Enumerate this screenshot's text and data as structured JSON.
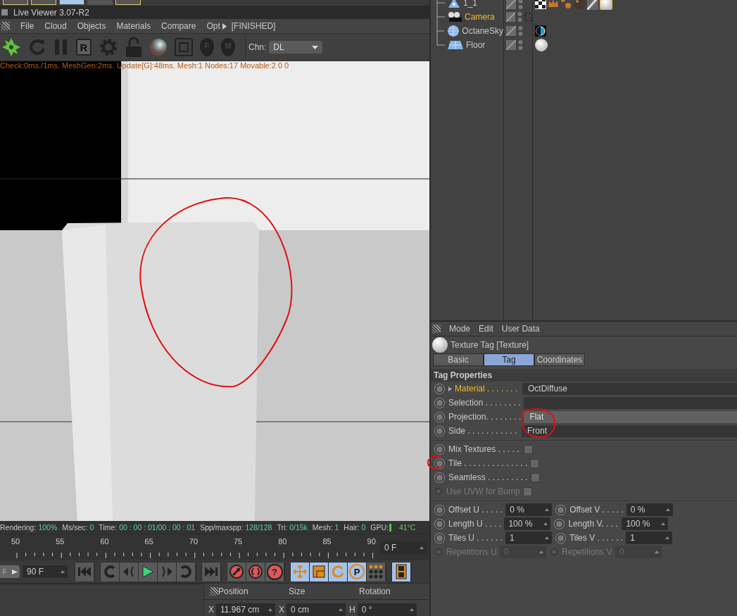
{
  "live_viewer": {
    "title": "Live Viewer 3.07-R2",
    "menu": [
      {
        "label": "File"
      },
      {
        "label": "Cloud"
      },
      {
        "label": "Objects"
      },
      {
        "label": "Materials"
      },
      {
        "label": "Compare"
      },
      {
        "label": "Opt"
      }
    ],
    "render_state": "[FINISHED]",
    "toolbar": [
      {
        "kind": "logo"
      },
      {
        "kind": "refresh"
      },
      {
        "kind": "pause"
      },
      {
        "kind": "letter",
        "glyph": "R"
      },
      {
        "kind": "gear"
      },
      {
        "kind": "lock"
      },
      {
        "kind": "sphere"
      },
      {
        "kind": "region"
      },
      {
        "kind": "pin",
        "glyph": "F"
      },
      {
        "kind": "pin",
        "glyph": "M"
      }
    ],
    "channel": {
      "label": "Chn:",
      "value": "DL"
    },
    "stats_line": "Check:0ms./1ms. MeshGen:2ms. Update[G]:48ms. Mesh:1 Nodes:17 Movable:2  0 0",
    "status": [
      {
        "label": "Rendering:",
        "value": "100%"
      },
      {
        "label": "Ms/sec:",
        "value": "0"
      },
      {
        "label": "Time:",
        "value": "00 : 00 : 01/00 : 00 : 01"
      },
      {
        "label": "Spp/maxspp:",
        "value": "128/128"
      },
      {
        "label": "Tri:",
        "value": "0/15k"
      },
      {
        "label": "Mesh:",
        "value": "1"
      },
      {
        "label": "Hair:",
        "value": "0"
      }
    ],
    "gpu": {
      "label": "GPU:",
      "value": "41°C"
    }
  },
  "timeline": {
    "ticks": [
      "50",
      "55",
      "60",
      "65",
      "70",
      "75",
      "80",
      "85",
      "90"
    ],
    "current_frame": "0 F"
  },
  "transport": {
    "start_label": "F",
    "end_frame": "90 F",
    "button_groups": [
      [
        {
          "kind": "to_start",
          "on": false
        }
      ],
      [
        {
          "kind": "prev_key",
          "on": false
        },
        {
          "kind": "prev_frame",
          "on": false
        },
        {
          "kind": "play",
          "on": false
        },
        {
          "kind": "next_frame",
          "on": false
        },
        {
          "kind": "next_key",
          "on": false
        }
      ],
      [
        {
          "kind": "to_end",
          "on": false
        }
      ],
      [
        {
          "kind": "record",
          "on": false
        },
        {
          "kind": "autokey",
          "on": false
        },
        {
          "kind": "help",
          "glyph": "?",
          "on": false
        }
      ],
      [
        {
          "kind": "move",
          "on": true
        },
        {
          "kind": "scale",
          "on": true
        },
        {
          "kind": "rotate",
          "on": true
        },
        {
          "kind": "param",
          "glyph": "P",
          "on": true
        },
        {
          "kind": "points",
          "on": false
        }
      ],
      [
        {
          "kind": "film",
          "on": true
        }
      ]
    ]
  },
  "coordinates": {
    "headers": [
      "Position",
      "Size",
      "Rotation"
    ],
    "fields": [
      {
        "axis": "X",
        "value": "11.967 cm"
      },
      {
        "axis": "X",
        "value": "0 cm"
      },
      {
        "axis": "H",
        "value": "0 °"
      }
    ]
  },
  "object_manager": {
    "objects": [
      {
        "name": "1_1",
        "kind": "null",
        "selected": false,
        "tags": [
          {
            "kind": "checker"
          },
          {
            "kind": "crown"
          },
          {
            "kind": "dots"
          },
          {
            "kind": "sphere_dark"
          },
          {
            "kind": "unknown"
          },
          {
            "kind": "sphere_white",
            "selected": true
          }
        ]
      },
      {
        "name": "Camera",
        "kind": "camera",
        "selected": true
      },
      {
        "name": "OctaneSky",
        "kind": "sky",
        "selected": false,
        "tags": [
          {
            "kind": "sky"
          }
        ]
      },
      {
        "name": "Floor",
        "kind": "floor",
        "selected": false,
        "tags": [
          {
            "kind": "sphere_white",
            "selected": false
          }
        ]
      }
    ]
  },
  "attributes": {
    "menu": [
      "Mode",
      "Edit",
      "User Data"
    ],
    "title": "Texture Tag [Texture]",
    "tabs": [
      {
        "label": "Basic",
        "selected": false
      },
      {
        "label": "Tag",
        "selected": true
      },
      {
        "label": "Coordinates",
        "selected": false
      }
    ],
    "section": "Tag Properties",
    "links": [
      {
        "label": "Material . . . . . . .",
        "value": "OctDiffuse",
        "highlighted": true,
        "focused": false
      },
      {
        "label": "Selection . . . . . . . .",
        "highlighted": false,
        "focused": false
      },
      {
        "label": "Projection. . . . . . . .",
        "value": "Flat",
        "highlighted": false,
        "focused": true
      },
      {
        "label": "Side . . . . . . . . . . .",
        "value": "Front",
        "highlighted": false,
        "focused": false
      }
    ],
    "checkboxes": [
      {
        "label": "Mix Textures . . . . .",
        "checked": false,
        "disabled": false
      },
      {
        "label": "Tile . . . . . . . . . . . . . .",
        "checked": false,
        "disabled": false
      },
      {
        "label": "Seamless . . . . . . . . .",
        "checked": false,
        "disabled": false
      },
      {
        "label": "Use UVW for Bump",
        "checked": false,
        "disabled": true
      }
    ],
    "numbers": [
      [
        {
          "label": "Offset U . . . . .",
          "value": "0 %",
          "disabled": false
        },
        {
          "label": "Offset V . . . . .",
          "value": "0 %",
          "disabled": false
        }
      ],
      [
        {
          "label": "Length U . . . .",
          "value": "100 %",
          "disabled": false
        },
        {
          "label": "Length V. . . .",
          "value": "100 %",
          "disabled": false
        }
      ],
      [
        {
          "label": "Tiles U . . . . . .",
          "value": "1",
          "disabled": false
        },
        {
          "label": "Tiles V . . . . . .",
          "value": "1",
          "disabled": false
        }
      ],
      [
        {
          "label": "Repetitions U",
          "value": "0",
          "disabled": true
        },
        {
          "label": "Repetitions V",
          "value": "0",
          "disabled": true
        }
      ]
    ]
  }
}
